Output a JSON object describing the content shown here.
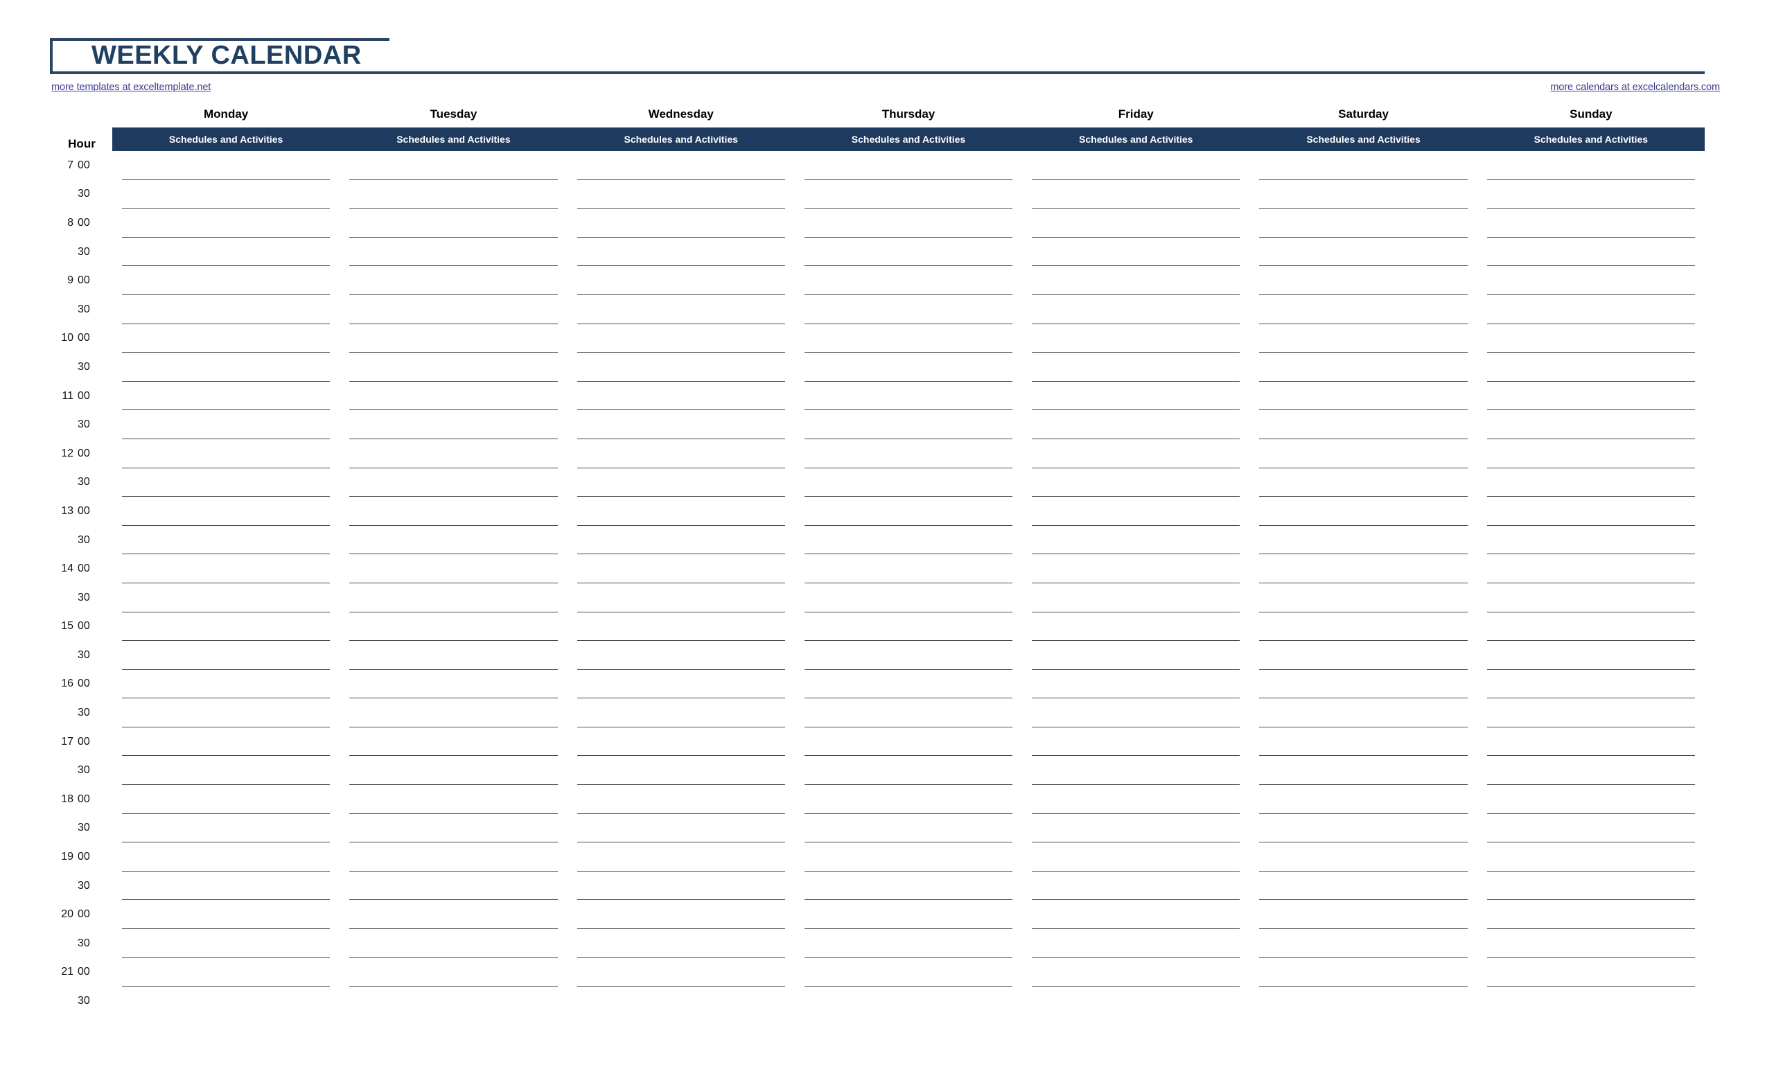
{
  "header": {
    "title": "WEEKLY CALENDAR",
    "link_left": "more templates at exceltemplate.net",
    "link_right": "more calendars at excelcalendars.com",
    "accent_color": "#1e3a5f",
    "title_color": "#1f4060",
    "link_color": "#3b3b8f"
  },
  "table": {
    "hour_column_label": "Hour",
    "sub_header_label": "Schedules and Activities",
    "days": [
      "Monday",
      "Tuesday",
      "Wednesday",
      "Thursday",
      "Friday",
      "Saturday",
      "Sunday"
    ],
    "rows": [
      {
        "hour": "7",
        "minute": "00"
      },
      {
        "hour": "",
        "minute": "30"
      },
      {
        "hour": "8",
        "minute": "00"
      },
      {
        "hour": "",
        "minute": "30"
      },
      {
        "hour": "9",
        "minute": "00"
      },
      {
        "hour": "",
        "minute": "30"
      },
      {
        "hour": "10",
        "minute": "00"
      },
      {
        "hour": "",
        "minute": "30"
      },
      {
        "hour": "11",
        "minute": "00"
      },
      {
        "hour": "",
        "minute": "30"
      },
      {
        "hour": "12",
        "minute": "00"
      },
      {
        "hour": "",
        "minute": "30"
      },
      {
        "hour": "13",
        "minute": "00"
      },
      {
        "hour": "",
        "minute": "30"
      },
      {
        "hour": "14",
        "minute": "00"
      },
      {
        "hour": "",
        "minute": "30"
      },
      {
        "hour": "15",
        "minute": "00"
      },
      {
        "hour": "",
        "minute": "30"
      },
      {
        "hour": "16",
        "minute": "00"
      },
      {
        "hour": "",
        "minute": "30"
      },
      {
        "hour": "17",
        "minute": "00"
      },
      {
        "hour": "",
        "minute": "30"
      },
      {
        "hour": "18",
        "minute": "00"
      },
      {
        "hour": "",
        "minute": "30"
      },
      {
        "hour": "19",
        "minute": "00"
      },
      {
        "hour": "",
        "minute": "30"
      },
      {
        "hour": "20",
        "minute": "00"
      },
      {
        "hour": "",
        "minute": "30"
      },
      {
        "hour": "21",
        "minute": "00"
      },
      {
        "hour": "",
        "minute": "30"
      }
    ]
  }
}
